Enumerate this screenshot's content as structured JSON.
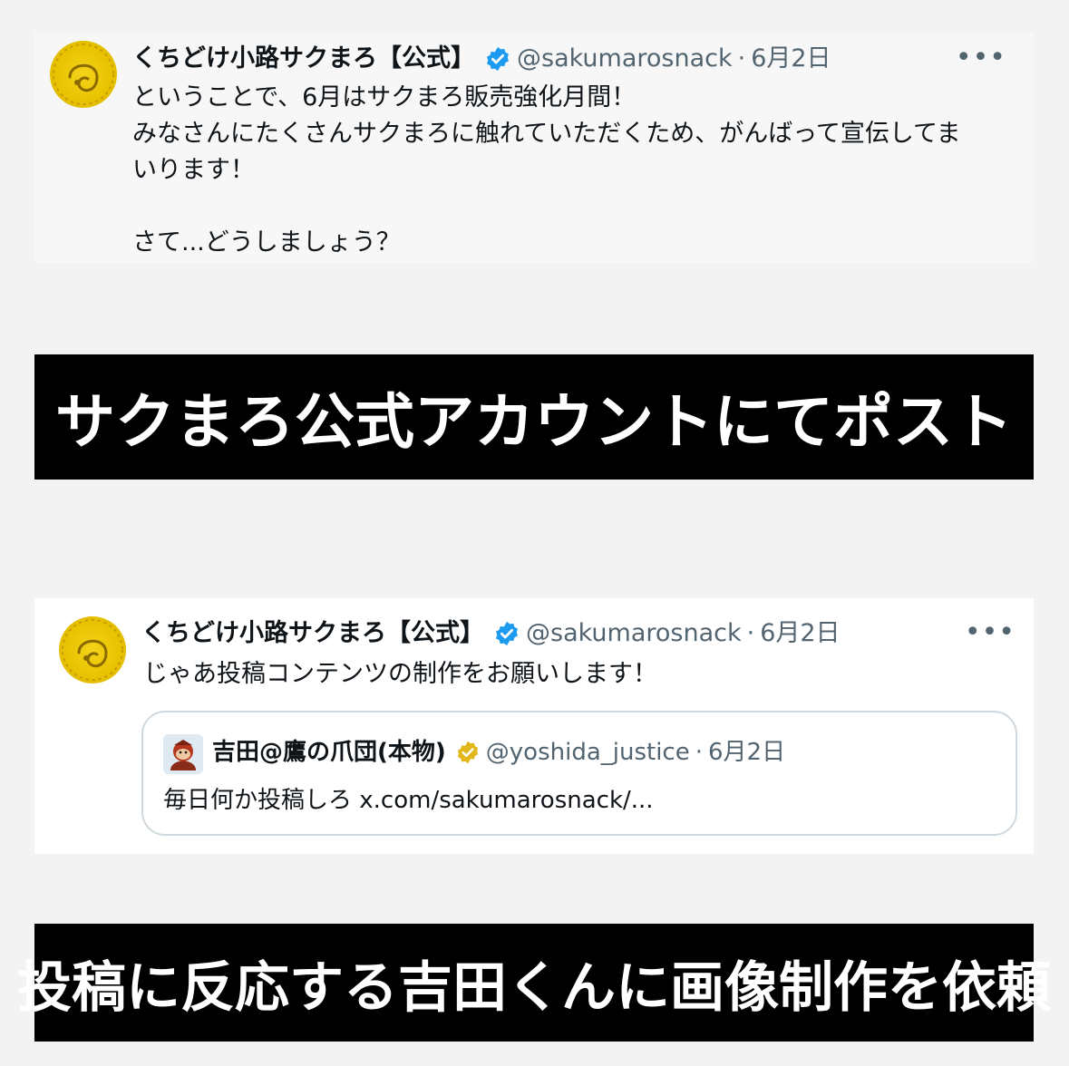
{
  "tweet1": {
    "display_name": "くちどけ小路サクまろ【公式】",
    "handle": "@sakumarosnack",
    "dot": "·",
    "date": "6月2日",
    "more": "•••",
    "text": "ということで、6月はサクまろ販売強化月間！\nみなさんにたくさんサクまろに触れていただくため、がんばって宣伝してま\nいります！\n\nさて...どうしましょう？"
  },
  "banner1": {
    "text": "サクまろ公式アカウントにてポスト"
  },
  "tweet2": {
    "display_name": "くちどけ小路サクまろ【公式】",
    "handle": "@sakumarosnack",
    "dot": "·",
    "date": "6月2日",
    "more": "•••",
    "text": "じゃあ投稿コンテンツの制作をお願いします！",
    "quote": {
      "display_name": "吉田@鷹の爪団(本物)",
      "handle": "@yoshida_justice",
      "dot": "·",
      "date": "6月2日",
      "text": "毎日何か投稿しろ x.com/sakumarosnack/..."
    }
  },
  "banner2": {
    "text": "投稿に反応する吉田くんに画像制作を依頼"
  },
  "colors": {
    "verified_blue": "#1d9bf0",
    "verified_gold": "#e2b719",
    "avatar_yellow": "#e8c200",
    "banner_bg": "#000000"
  },
  "icons": [
    "mascot-avatar",
    "verified-badge-blue",
    "verified-badge-gold",
    "more-options-icon",
    "yoshida-avatar"
  ]
}
